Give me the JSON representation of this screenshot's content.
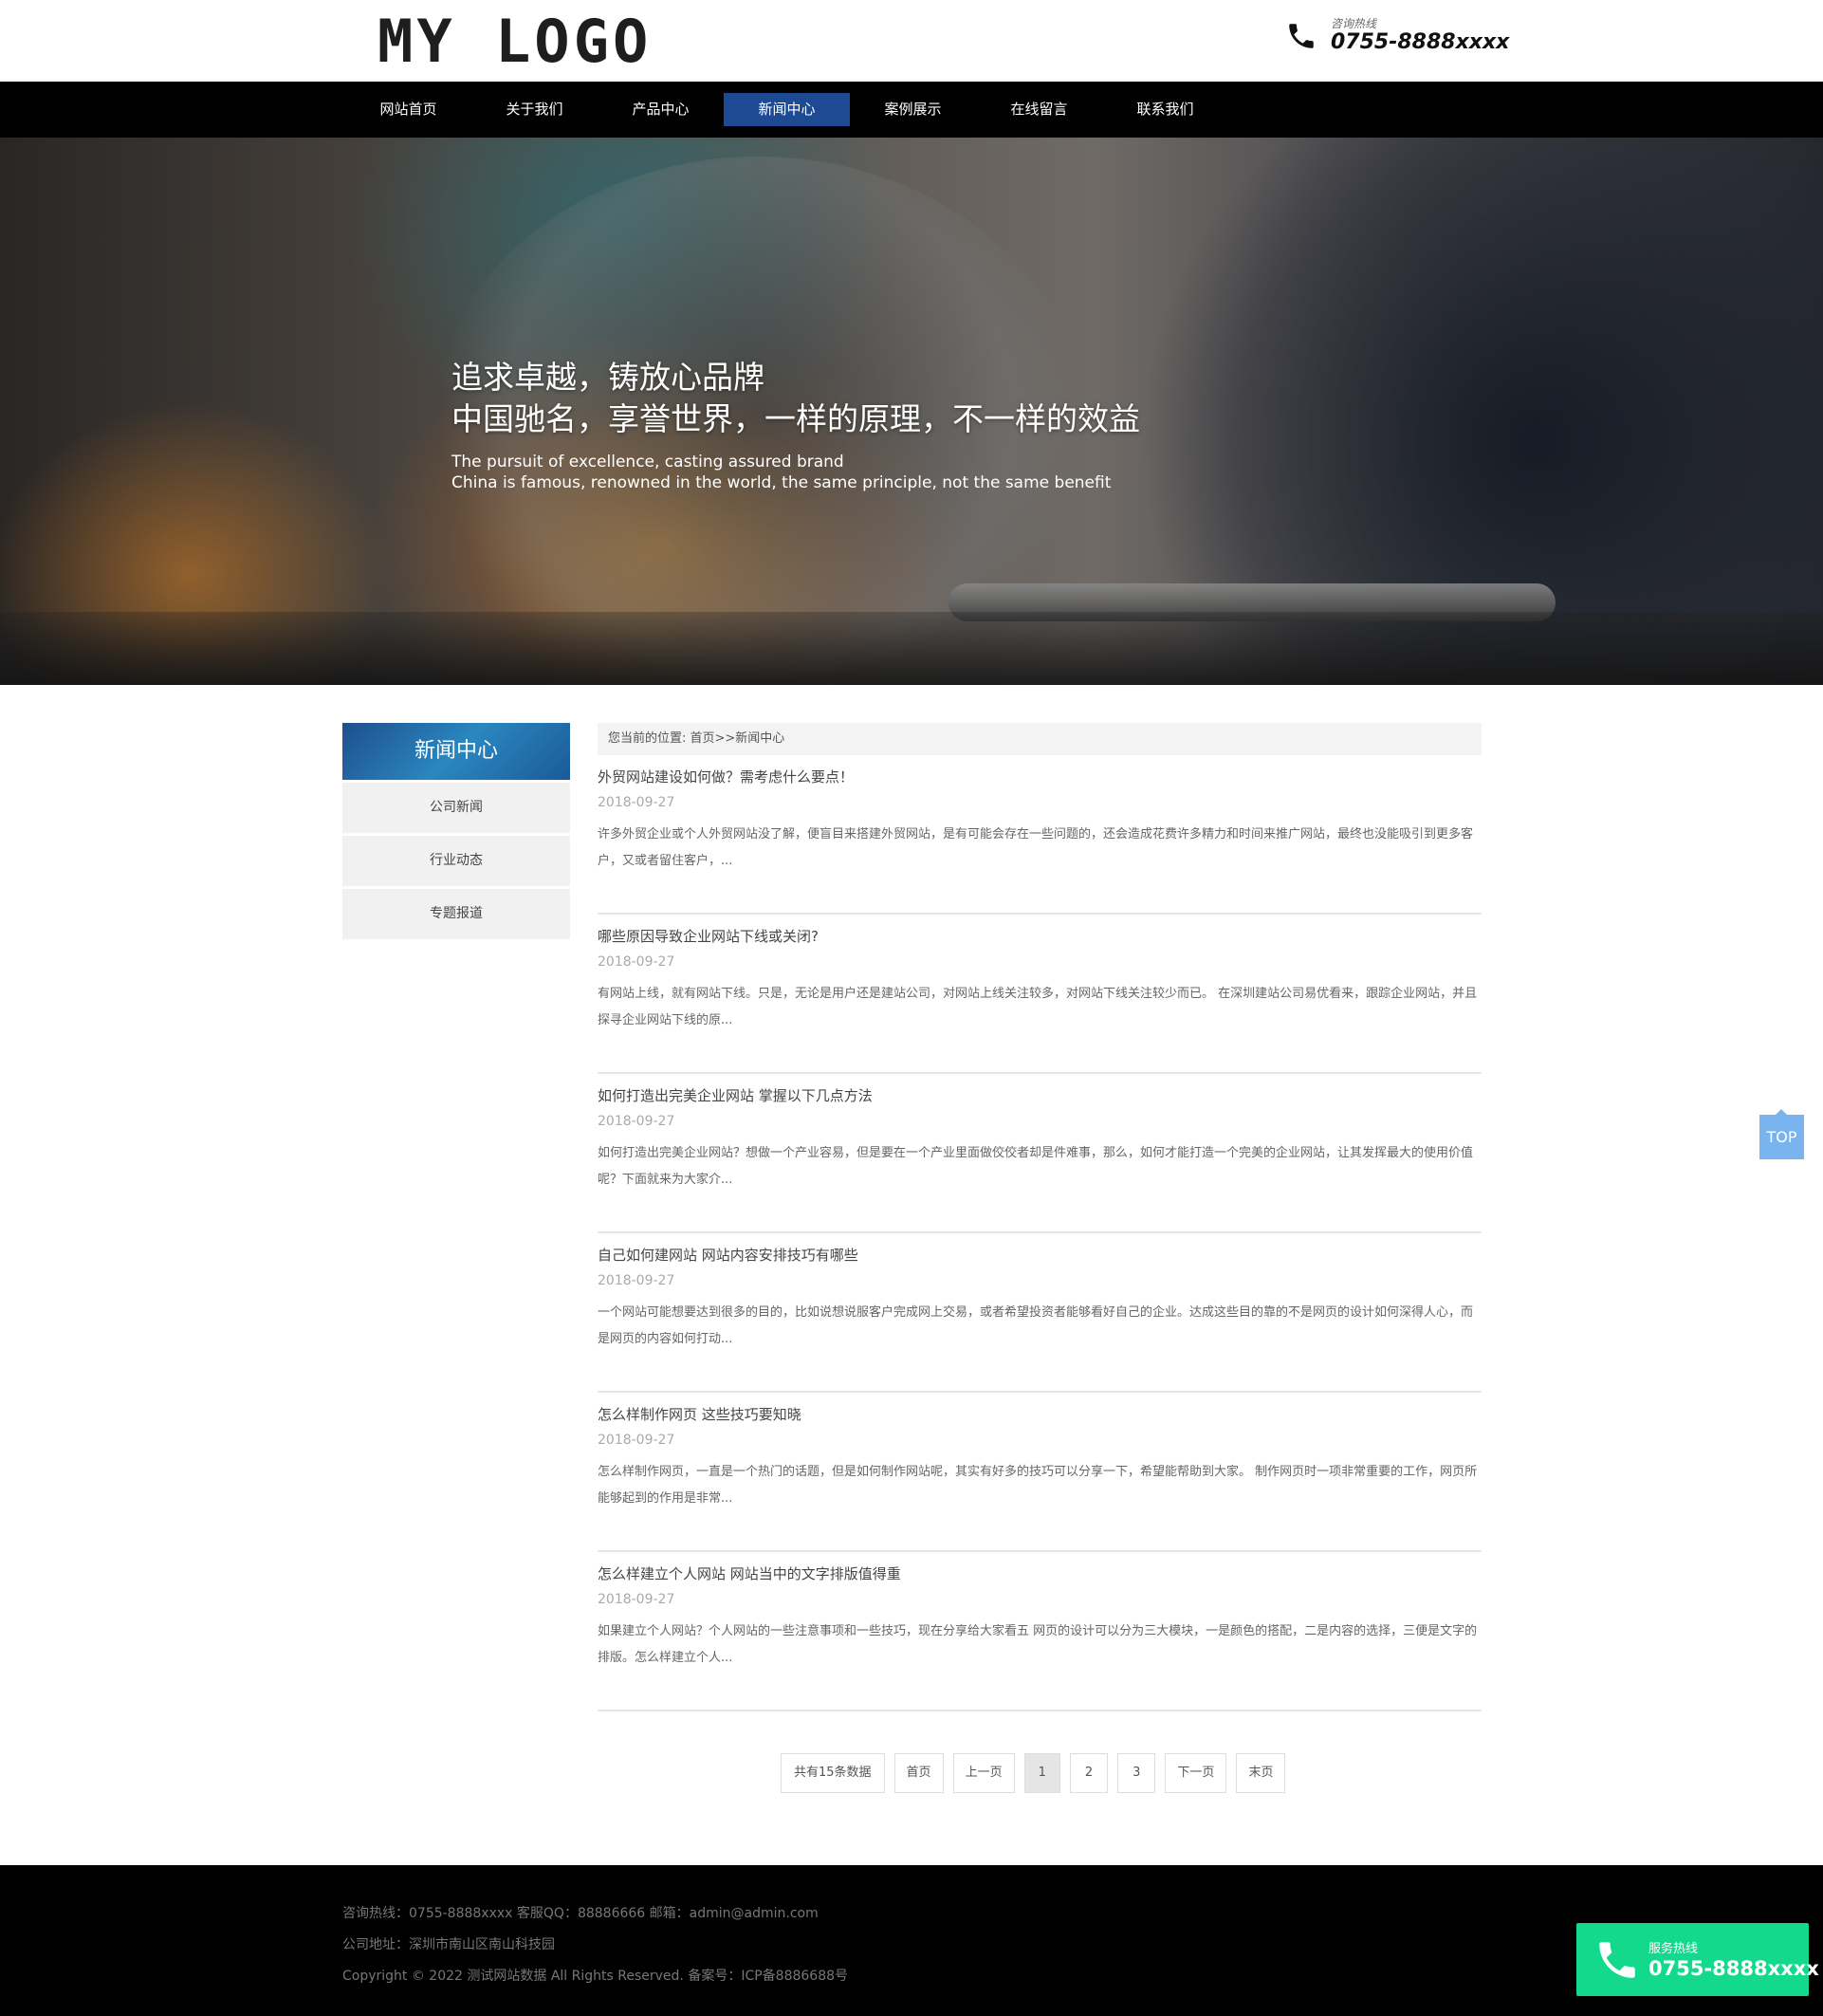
{
  "header": {
    "logo": "MY LOGO",
    "hotline_label": "咨询热线",
    "hotline_number": "0755-8888xxxx"
  },
  "nav": {
    "items": [
      {
        "label": "网站首页"
      },
      {
        "label": "关于我们"
      },
      {
        "label": "产品中心"
      },
      {
        "label": "新闻中心",
        "active": true
      },
      {
        "label": "案例展示"
      },
      {
        "label": "在线留言"
      },
      {
        "label": "联系我们"
      }
    ],
    "active_color": "#1e4a94"
  },
  "banner": {
    "line1": "追求卓越，铸放心品牌",
    "line2": "中国驰名，享誉世界，一样的原理，不一样的效益",
    "line3": "The pursuit of excellence, casting assured brand",
    "line4": "China is famous, renowned in the world, the same principle, not the same benefit"
  },
  "sidebar": {
    "title": "新闻中心",
    "items": [
      {
        "label": "公司新闻"
      },
      {
        "label": "行业动态"
      },
      {
        "label": "专题报道"
      }
    ]
  },
  "breadcrumb": "您当前的位置: 首页>>新闻中心",
  "news": [
    {
      "title": "外贸网站建设如何做？需考虑什么要点！",
      "date": "2018-09-27",
      "desc": "许多外贸企业或个人外贸网站没了解，便盲目来搭建外贸网站，是有可能会存在一些问题的，还会造成花费许多精力和时间来推广网站，最终也没能吸引到更多客户，又或者留住客户，..."
    },
    {
      "title": "哪些原因导致企业网站下线或关闭?",
      "date": "2018-09-27",
      "desc": "有网站上线，就有网站下线。只是，无论是用户还是建站公司，对网站上线关注较多，对网站下线关注较少而已。 在深圳建站公司易优看来，跟踪企业网站，并且探寻企业网站下线的原..."
    },
    {
      "title": "如何打造出完美企业网站 掌握以下几点方法",
      "date": "2018-09-27",
      "desc": "如何打造出完美企业网站？想做一个产业容易，但是要在一个产业里面做佼佼者却是件难事，那么，如何才能打造一个完美的企业网站，让其发挥最大的使用价值呢？下面就来为大家介..."
    },
    {
      "title": "自己如何建网站 网站内容安排技巧有哪些",
      "date": "2018-09-27",
      "desc": "一个网站可能想要达到很多的目的，比如说想说服客户完成网上交易，或者希望投资者能够看好自己的企业。达成这些目的靠的不是网页的设计如何深得人心，而是网页的内容如何打动..."
    },
    {
      "title": "怎么样制作网页 这些技巧要知晓",
      "date": "2018-09-27",
      "desc": "怎么样制作网页，一直是一个热门的话题，但是如何制作网站呢，其实有好多的技巧可以分享一下，希望能帮助到大家。 制作网页时一项非常重要的工作，网页所能够起到的作用是非常..."
    },
    {
      "title": "怎么样建立个人网站 网站当中的文字排版值得重",
      "date": "2018-09-27",
      "desc": "如果建立个人网站？个人网站的一些注意事项和一些技巧，现在分享给大家看五 网页的设计可以分为三大模块，一是颜色的搭配，二是内容的选择，三便是文字的排版。怎么样建立个人..."
    }
  ],
  "pager": {
    "count": "共有15条数据",
    "first": "首页",
    "prev": "上一页",
    "pages": [
      "1",
      "2",
      "3"
    ],
    "next": "下一页",
    "last": "末页"
  },
  "top_button": "TOP",
  "footer": {
    "line1": "咨询热线：0755-8888xxxx    客服QQ：88886666    邮箱：admin@admin.com",
    "line2": "公司地址：深圳市南山区南山科技园",
    "line3": "Copyright © 2022 测试网站数据 All Rights Reserved.  备案号：ICP备8886688号"
  },
  "service": {
    "label": "服务热线",
    "number": "0755-8888xxxx",
    "color": "#12d98b"
  }
}
